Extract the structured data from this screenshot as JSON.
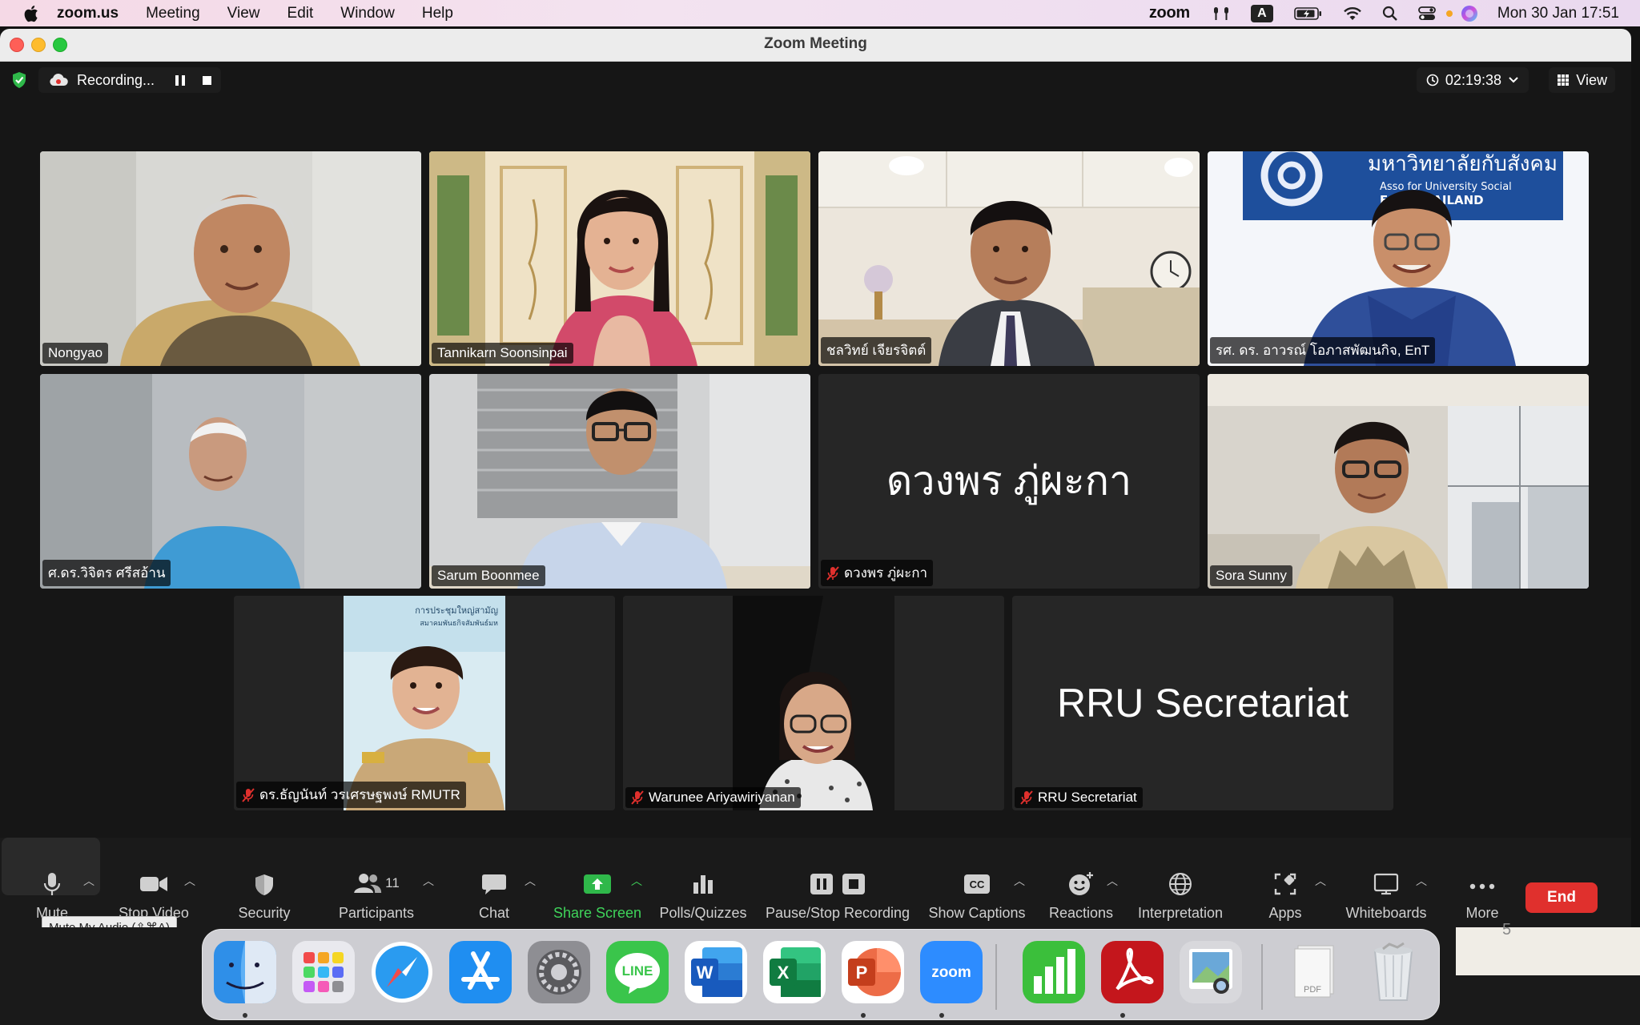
{
  "menubar": {
    "app_name": "zoom.us",
    "menus": [
      "Meeting",
      "View",
      "Edit",
      "Window",
      "Help"
    ],
    "zoom_status": "zoom",
    "input_source": "A",
    "clock": "Mon 30 Jan  17:51"
  },
  "window": {
    "title": "Zoom Meeting",
    "recording_label": "Recording...",
    "elapsed": "02:19:38",
    "view_label": "View"
  },
  "participants": [
    {
      "name": "Nongyao",
      "muted": false,
      "video": true,
      "speaking": false
    },
    {
      "name": "Tannikarn Soonsinpai",
      "muted": false,
      "video": true,
      "speaking": true
    },
    {
      "name": "ชลวิทย์ เจียรจิตต์",
      "muted": false,
      "video": true,
      "speaking": false
    },
    {
      "name": "รศ. ดร. อาวรณ์ โอภาสพัฒนกิจ, EnT",
      "muted": false,
      "video": true,
      "speaking": false
    },
    {
      "name": "ศ.ดร.วิจิตร ศรีสอ้าน",
      "muted": false,
      "video": true,
      "speaking": false
    },
    {
      "name": "Sarum Boonmee",
      "muted": false,
      "video": true,
      "speaking": false
    },
    {
      "name": "ดวงพร ภู่ผะกา",
      "muted": true,
      "video": false,
      "speaking": false
    },
    {
      "name": "Sora Sunny",
      "muted": false,
      "video": true,
      "speaking": false
    },
    {
      "name": "ดร.ธัญนันท์ วรเศรษฐพงษ์ RMUTR",
      "muted": true,
      "video": true,
      "speaking": false
    },
    {
      "name": "Warunee Ariyawiriyanan",
      "muted": true,
      "video": true,
      "speaking": false
    },
    {
      "name": "RRU Secretariat",
      "muted": true,
      "video": false,
      "speaking": false
    }
  ],
  "virtual_backgrounds": {
    "banner_thai": "มหาวิทยาลัยกับสังคม",
    "banner_line2": "Asso      for University Social",
    "banner_line3": "E     NT THAILAND",
    "backdrop_line1": "การประชุมใหญ่สามัญ",
    "backdrop_line2": "สมาคมพันธกิจสัมพันธ์มห"
  },
  "toolbar": {
    "mute": "Mute",
    "stop_video": "Stop Video",
    "security": "Security",
    "participants": "Participants",
    "participant_count": "11",
    "chat": "Chat",
    "share_screen": "Share Screen",
    "polls": "Polls/Quizzes",
    "recording": "Pause/Stop Recording",
    "captions": "Show Captions",
    "reactions": "Reactions",
    "interpretation": "Interpretation",
    "apps": "Apps",
    "whiteboards": "Whiteboards",
    "more": "More",
    "end": "End",
    "captions_badge": "CC"
  },
  "tooltip": "Mute My Audio (⇧⌘A)",
  "desktop": {
    "page_number": "5"
  },
  "dock": {
    "apps": [
      "Finder",
      "Launchpad",
      "Safari",
      "App Store",
      "System Settings",
      "LINE",
      "Microsoft Word",
      "Microsoft Excel",
      "Microsoft PowerPoint",
      "Zoom",
      "Numbers",
      "Adobe Acrobat",
      "Preview",
      "PDF Documents",
      "Trash"
    ],
    "line_label": "LINE",
    "word_letter": "W",
    "excel_letter": "X",
    "ppt_letter": "P",
    "zoom_label": "zoom",
    "pdf_label": "PDF"
  },
  "colors": {
    "speaking_outline": "#32c94a",
    "share_green": "#3fd45a",
    "end_red": "#e0302d"
  }
}
